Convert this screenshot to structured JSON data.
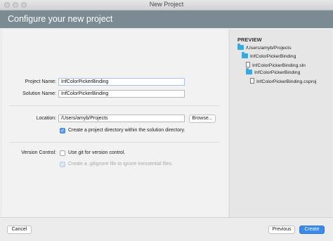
{
  "window": {
    "title": "New Project"
  },
  "header": {
    "title": "Configure your new project"
  },
  "form": {
    "project_name_label": "Project Name:",
    "project_name_value": "InfColorPickerBinding",
    "solution_name_label": "Solution Name:",
    "solution_name_value": "InfColorPickerBinding",
    "location_label": "Location:",
    "location_value": "/Users/amyb/Projects",
    "browse_label": "Browse...",
    "create_directory_label": "Create a project directory within the solution directory.",
    "create_directory_checked": true,
    "version_control_label": "Version Control:",
    "use_git_label": "Use git for version control.",
    "use_git_checked": false,
    "gitignore_label": "Create a .gitignore file to ignore inessential files.",
    "gitignore_checked": true,
    "gitignore_enabled": false
  },
  "preview": {
    "heading": "PREVIEW",
    "tree": [
      {
        "label": "/Users/amyb/Projects",
        "icon": "folder-icon",
        "level": 0
      },
      {
        "label": "InfColorPickerBinding",
        "icon": "folder-icon",
        "level": 1
      },
      {
        "label": "InfColorPickerBinding.sln",
        "icon": "file-icon",
        "level": 2
      },
      {
        "label": "InfColorPickerBinding",
        "icon": "folder-icon",
        "level": 2
      },
      {
        "label": "InfColorPickerBinding.csproj",
        "icon": "file-icon",
        "level": 3
      }
    ]
  },
  "footer": {
    "cancel_label": "Cancel",
    "previous_label": "Previous",
    "create_label": "Create"
  },
  "colors": {
    "header_bg": "#7c8a94",
    "accent": "#3e88e8",
    "folder": "#39a8dc"
  }
}
